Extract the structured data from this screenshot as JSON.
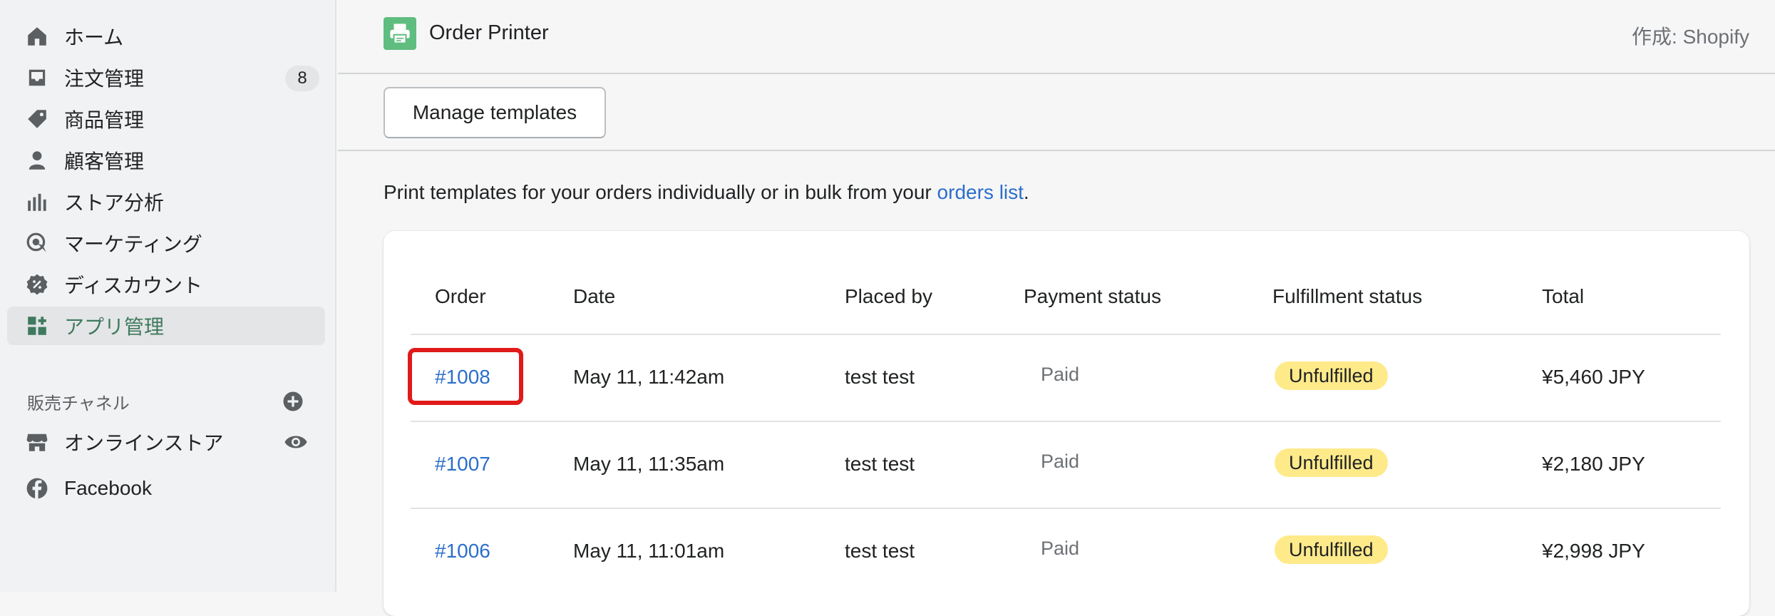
{
  "sidebar": {
    "items": [
      {
        "label": "ホーム",
        "icon": "home-icon"
      },
      {
        "label": "注文管理",
        "icon": "orders-icon",
        "badge": "8"
      },
      {
        "label": "商品管理",
        "icon": "tag-icon"
      },
      {
        "label": "顧客管理",
        "icon": "person-icon"
      },
      {
        "label": "ストア分析",
        "icon": "analytics-icon"
      },
      {
        "label": "マーケティング",
        "icon": "marketing-icon"
      },
      {
        "label": "ディスカウント",
        "icon": "discount-icon"
      },
      {
        "label": "アプリ管理",
        "icon": "apps-icon",
        "active": true
      }
    ],
    "sales_channels_label": "販売チャネル",
    "channels": [
      {
        "label": "オンラインストア",
        "icon": "store-icon"
      },
      {
        "label": "Facebook",
        "icon": "facebook-icon"
      }
    ]
  },
  "header": {
    "app_title": "Order Printer",
    "made_by": "作成: Shopify"
  },
  "toolbar": {
    "manage_templates_label": "Manage templates"
  },
  "intro": {
    "text": "Print templates for your orders individually or in bulk from your ",
    "link": "orders list",
    "suffix": "."
  },
  "table": {
    "columns": [
      "Order",
      "Date",
      "Placed by",
      "Payment status",
      "Fulfillment status",
      "Total"
    ],
    "rows": [
      {
        "order": "#1008",
        "date": "May 11, 11:42am",
        "placed_by": "test test",
        "payment": "Paid",
        "fulfillment": "Unfulfilled",
        "total": "¥5,460 JPY"
      },
      {
        "order": "#1007",
        "date": "May 11, 11:35am",
        "placed_by": "test test",
        "payment": "Paid",
        "fulfillment": "Unfulfilled",
        "total": "¥2,180 JPY"
      },
      {
        "order": "#1006",
        "date": "May 11, 11:01am",
        "placed_by": "test test",
        "payment": "Paid",
        "fulfillment": "Unfulfilled",
        "total": "¥2,998 JPY"
      }
    ]
  },
  "colors": {
    "accent_green": "#3f7a5e",
    "link_blue": "#2c6ecb",
    "badge_yellow": "#ffea8a",
    "highlight_red": "#e01a1a"
  }
}
